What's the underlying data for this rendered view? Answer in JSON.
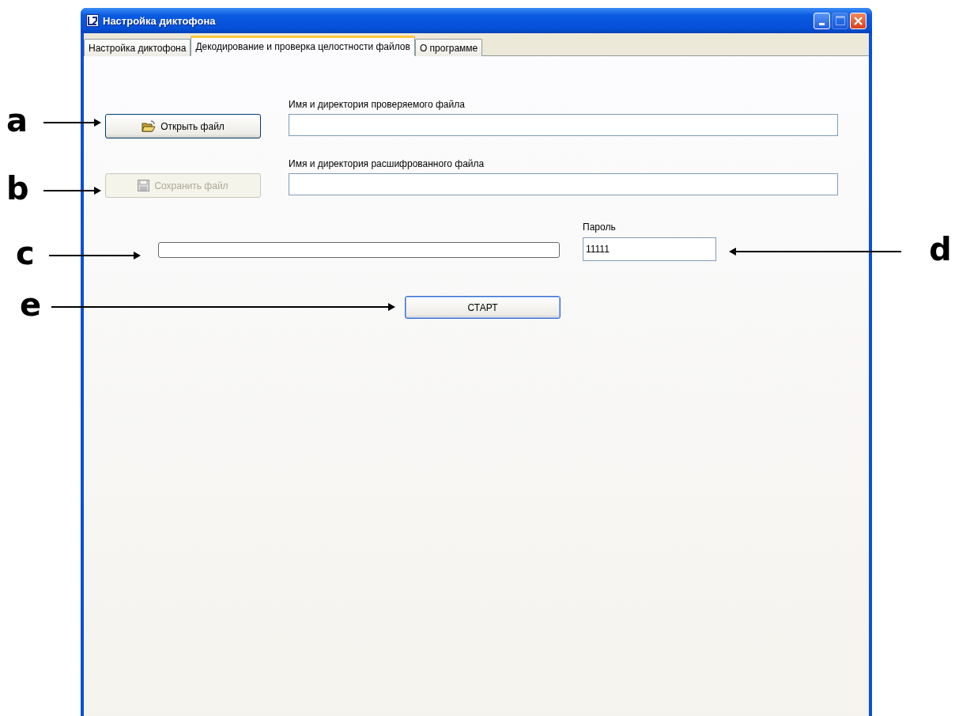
{
  "window": {
    "title": "Настройка диктофона",
    "title_buttons": [
      {
        "kind": "minimize",
        "disabled": false
      },
      {
        "kind": "maximize",
        "disabled": true
      },
      {
        "kind": "close",
        "disabled": false
      }
    ]
  },
  "tabs": [
    {
      "label": "Настройка диктофона",
      "selected": false
    },
    {
      "label": "Декодирование и проверка целостности файлов",
      "selected": true
    },
    {
      "label": "О программе",
      "selected": false
    }
  ],
  "file_rows": [
    {
      "button": "Открыть файл",
      "kind": "open",
      "disabled": false,
      "field_label": "Имя и директория проверяемого файла",
      "value": ""
    },
    {
      "button": "Сохранить файл",
      "kind": "save",
      "disabled": true,
      "field_label": "Имя и директория расшифрованного файла",
      "value": ""
    }
  ],
  "progress": {
    "level": 0
  },
  "password": {
    "label": "Пароль",
    "value": "11111"
  },
  "start_button": "СТАРТ",
  "callouts": [
    {
      "letter": "a"
    },
    {
      "letter": "b"
    },
    {
      "letter": "c"
    },
    {
      "letter": "d"
    },
    {
      "letter": "e"
    }
  ]
}
